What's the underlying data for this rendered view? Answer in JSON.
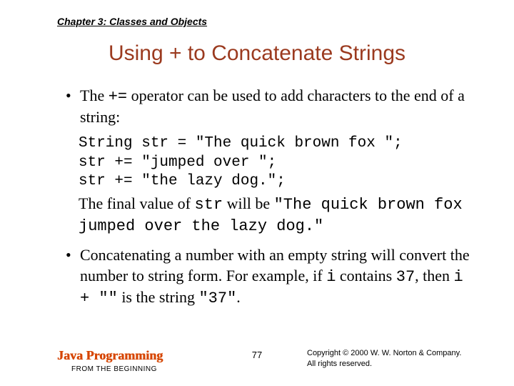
{
  "header": {
    "chapter": "Chapter 3: Classes and Objects"
  },
  "title": "Using + to Concatenate Strings",
  "bullet1": {
    "pre": "The ",
    "op": "+=",
    "post": " operator can be used to add characters to the end of a string:"
  },
  "code": "String str = \"The quick brown fox \";\nstr += \"jumped over \";\nstr += \"the lazy dog.\";",
  "result": {
    "pre": "The final value of ",
    "var": "str",
    "mid": " will be ",
    "val": "\"The quick brown fox jumped over the lazy dog.\""
  },
  "bullet2": {
    "s1": "Concatenating a number with an empty string will convert the number to string form. For example, if ",
    "v1": "i",
    "s2": " contains ",
    "n1": "37",
    "s3": ", then ",
    "expr": "i + \"\"",
    "s4": " is the string ",
    "res": "\"37\"",
    "s5": "."
  },
  "footer": {
    "book_title": "Java Programming",
    "book_sub": "FROM THE BEGINNING",
    "page_num": "77",
    "copyright_l1": "Copyright © 2000 W. W. Norton & Company.",
    "copyright_l2": "All rights reserved."
  }
}
